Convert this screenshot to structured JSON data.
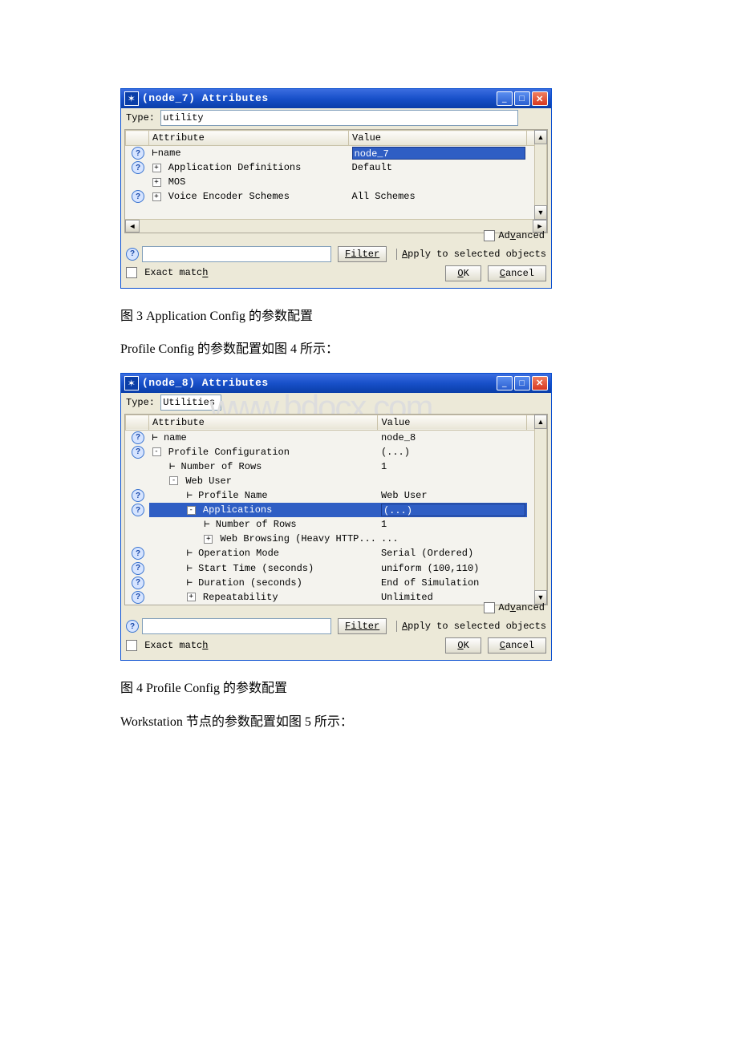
{
  "win1": {
    "title": "(node_7) Attributes",
    "type_label": "Type:",
    "type_value": "utility",
    "cols": {
      "attr": "Attribute",
      "val": "Value"
    },
    "rows": [
      {
        "q": true,
        "attr": "⊢name",
        "val": "node_7",
        "selected": true
      },
      {
        "q": true,
        "expander": "+",
        "attr": "Application Definitions",
        "val": "Default"
      },
      {
        "q": false,
        "expander": "+",
        "attr": "MOS",
        "val": ""
      },
      {
        "q": true,
        "expander": "+",
        "attr": "Voice Encoder Schemes",
        "val": "All Schemes"
      }
    ],
    "filter_label": "Filter",
    "advanced_label": "Advanced",
    "apply_label": "Apply to selected objects",
    "exact_label": "Exact match",
    "ok": "OK",
    "cancel": "Cancel"
  },
  "caption3": "图 3 Application Config 的参数配置",
  "mid1": "Profile Config 的参数配置如图 4 所示：",
  "watermark": "www.bdocx.com",
  "win2": {
    "title": "(node_8) Attributes",
    "type_label": "Type:",
    "type_value": "Utilities",
    "cols": {
      "attr": "Attribute",
      "val": "Value"
    },
    "rows": [
      {
        "q": true,
        "indent": 0,
        "prefix": "⊢",
        "attr": "name",
        "val": "node_8"
      },
      {
        "q": true,
        "indent": 0,
        "expander": "-",
        "attr": "Profile Configuration",
        "val": "(...)"
      },
      {
        "q": false,
        "indent": 1,
        "prefix": "⊢",
        "attr": "Number of Rows",
        "val": "1"
      },
      {
        "q": false,
        "indent": 1,
        "expander": "-",
        "attr": "Web User",
        "val": ""
      },
      {
        "q": true,
        "indent": 2,
        "prefix": "⊢",
        "attr": "Profile Name",
        "val": "Web User"
      },
      {
        "q": true,
        "indent": 2,
        "expander": "-",
        "attr": "Applications",
        "val": "(...)",
        "selected": true,
        "box": true
      },
      {
        "q": false,
        "indent": 3,
        "prefix": "⊢",
        "attr": "Number of Rows",
        "val": "1"
      },
      {
        "q": false,
        "indent": 3,
        "expander": "+",
        "attr": "Web Browsing (Heavy HTTP...",
        "val": "..."
      },
      {
        "q": true,
        "indent": 2,
        "prefix": "⊢",
        "attr": "Operation Mode",
        "val": "Serial (Ordered)"
      },
      {
        "q": true,
        "indent": 2,
        "prefix": "⊢",
        "attr": "Start Time (seconds)",
        "val": "uniform (100,110)"
      },
      {
        "q": true,
        "indent": 2,
        "prefix": "⊢",
        "attr": "Duration (seconds)",
        "val": "End of Simulation"
      },
      {
        "q": true,
        "indent": 2,
        "expander": "+",
        "attr": "Repeatability",
        "val": "Unlimited"
      }
    ],
    "filter_label": "Filter",
    "advanced_label": "Advanced",
    "apply_label": "Apply to selected objects",
    "exact_label": "Exact match",
    "ok": "OK",
    "cancel": "Cancel"
  },
  "caption4": "图 4 Profile Config 的参数配置",
  "mid2": "Workstation 节点的参数配置如图 5 所示："
}
